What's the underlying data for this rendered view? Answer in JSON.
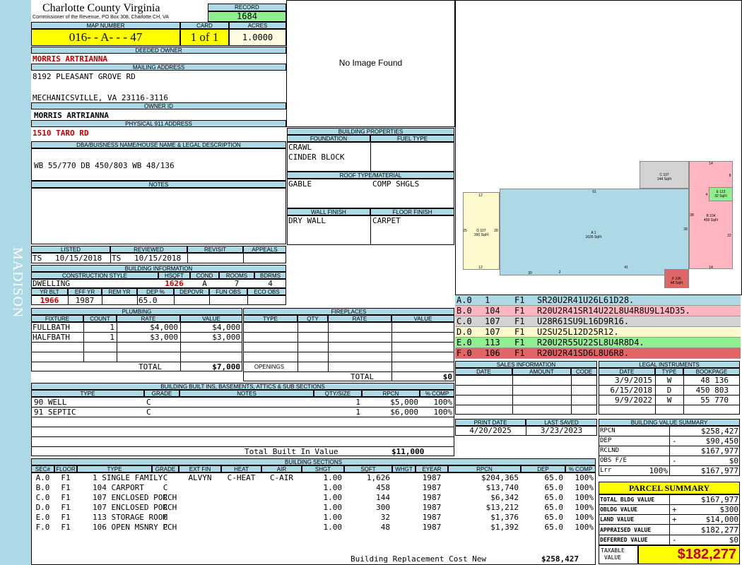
{
  "side_label": "MADISON",
  "header": {
    "county": "Charlotte County Virginia",
    "office": "Commissioner of the Revenue, PO Box 308, Charlotte CH, VA",
    "record_label": "RECORD",
    "record": "1684",
    "map_label": "MAP NUMBER",
    "map_number": "016- - A- - - 47",
    "card_label": "CARD",
    "card": "1 of 1",
    "acres_label": "ACRES",
    "acres": "1.0000"
  },
  "owner": {
    "deeded_label": "DEEDED OWNER",
    "deeded_owner": "MORRIS ARTRIANNA",
    "mailing_label": "MAILING ADDRESS",
    "address1": "8192 PLEASANT GROVE RD",
    "address2": "MECHANICSVILLE, VA 23116-3116",
    "owner_id_label": "OWNER ID",
    "owner_id": "MORRIS ARTRIANNA",
    "physical_label": "PHYSICAL 911 ADDRESS",
    "physical": "1510 TARO RD"
  },
  "dba": {
    "label": "DBA/BUISNESS NAME/HOUSE NAME & LEGAL DESCRIPTION",
    "value": "WB 55/770 DB 450/803 WB 48/136"
  },
  "notes_label": "NOTES",
  "image": {
    "text": "No Image Found"
  },
  "building_properties": {
    "label": "BUILDING PROPERTIES",
    "foundation_label": "FOUNDATION",
    "fuel_label": "FUEL TYPE",
    "foundation1": "CRAWL",
    "foundation2": "CINDER BLOCK",
    "roof_label": "ROOF TYPE/MATERIAL",
    "roof_type": "GABLE",
    "roof_material": "COMP SHGLS",
    "wall_label": "WALL FINISH",
    "floor_label": "FLOOR FINISH",
    "wall": "DRY WALL",
    "floor": "CARPET"
  },
  "dates": {
    "listed_label": "LISTED",
    "reviewed_label": "REVIEWED",
    "revisit_label": "REVISIT",
    "appeals_label": "APPEALS",
    "listed_by": "TS",
    "listed": "10/15/2018",
    "reviewed_by": "TS",
    "reviewed": "10/15/2018"
  },
  "building_info": {
    "label": "BUILDING INFORMATION",
    "style_label": "CONSTRUCTION STYLE",
    "hsqft_label": "HSQFT",
    "cond_label": "COND",
    "rooms_label": "ROOMS",
    "bdrms_label": "BDRMS",
    "style": "DWELLING",
    "hsqft": "1626",
    "cond": "A",
    "rooms": "7",
    "bdrms": "4",
    "yrblt_label": "YR BLT",
    "effyr_label": "EFF YR",
    "remyr_label": "REM YR",
    "dep_label": "DEP %",
    "depovr_label": "DEPOVR",
    "funobs_label": "FUN OBS",
    "ecoobs_label": "ECO OBS",
    "yrblt": "1966",
    "effyr": "1987",
    "dep": "65.0"
  },
  "plumbing": {
    "label": "PLUMBING",
    "headers": [
      "FIXTURE",
      "COUNT",
      "RATE",
      "VALUE"
    ],
    "rows": [
      [
        "FULLBATH",
        "1",
        "$4,000",
        "$4,000"
      ],
      [
        "HALFBATH",
        "1",
        "$3,000",
        "$3,000"
      ]
    ],
    "total_label": "TOTAL",
    "total": "$7,000"
  },
  "fireplaces": {
    "label": "FIREPLACES",
    "headers": [
      "TYPE",
      "QTY",
      "RATE",
      "VALUE"
    ],
    "openings_label": "OPENINGS",
    "total_label": "TOTAL",
    "total": "$0"
  },
  "built_ins": {
    "label": "BUILDING BUILT INS, BASEMENTS, ATTICS & SUB SECTIONS",
    "headers": [
      "TYPE",
      "GRADE",
      "NOTES",
      "QTY/SIZE",
      "RPCN",
      "% COMP"
    ],
    "rows": [
      [
        "90 WELL",
        "C",
        "",
        "1",
        "$5,000",
        "100%"
      ],
      [
        "91 SEPTIC",
        "C",
        "",
        "1",
        "$6,000",
        "100%"
      ]
    ],
    "total_label": "Total Built In Value",
    "total": "$11,000"
  },
  "sections": {
    "label": "BUILDING SECTIONS",
    "headers": [
      "SEC#",
      "FLOOR",
      "TYPE",
      "GRADE",
      "EXT FIN",
      "HEAT",
      "AIR",
      "SHGT",
      "SQFT",
      "WHGT",
      "EYEAR",
      "RPCN",
      "DEP",
      "% COMP"
    ],
    "rows": [
      [
        "A.0",
        "F1",
        "1 SINGLE FAMILY",
        "C",
        "ALVYN",
        "C-HEAT",
        "C-AIR",
        "1.00",
        "1,626",
        "",
        "1987",
        "$204,365",
        "65.0",
        "100%"
      ],
      [
        "B.0",
        "F1",
        "104 CARPORT",
        "C",
        "",
        "",
        "",
        "1.00",
        "458",
        "",
        "1987",
        "$13,740",
        "65.0",
        "100%"
      ],
      [
        "C.0",
        "F1",
        "107 ENCLOSED PORCH",
        "C",
        "",
        "",
        "",
        "1.00",
        "144",
        "",
        "1987",
        "$6,342",
        "65.0",
        "100%"
      ],
      [
        "D.0",
        "F1",
        "107 ENCLOSED PORCH",
        "C",
        "",
        "",
        "",
        "1.00",
        "300",
        "",
        "1987",
        "$13,212",
        "65.0",
        "100%"
      ],
      [
        "E.0",
        "F1",
        "113 STORAGE ROOM",
        "C",
        "",
        "",
        "",
        "1.00",
        "32",
        "",
        "1987",
        "$1,376",
        "65.0",
        "100%"
      ],
      [
        "F.0",
        "F1",
        "106 OPEN MSNRY PCH",
        "C",
        "",
        "",
        "",
        "1.00",
        "48",
        "",
        "1987",
        "$1,392",
        "65.0",
        "100%"
      ]
    ],
    "total_label": "Building Replacement Cost New",
    "total": "$258,427"
  },
  "sketch": {
    "labels": [
      {
        "id": "A",
        "name": "A 1",
        "area": "1626 SqFt"
      },
      {
        "id": "B",
        "name": "B 104",
        "area": "458 SqFt"
      },
      {
        "id": "C",
        "name": "C 107",
        "area": "144 SqFt"
      },
      {
        "id": "D",
        "name": "D 107",
        "area": "300 SqFt"
      },
      {
        "id": "E",
        "name": "E 113",
        "area": "32 SqFt"
      },
      {
        "id": "F",
        "name": "F 106",
        "area": "48 SqFt"
      }
    ],
    "dims": [
      "12",
      "61",
      "25",
      "28",
      "30",
      "2",
      "41",
      "12",
      "14",
      "8",
      "4",
      "22",
      "14",
      "38",
      "28",
      "22",
      "14"
    ],
    "colors": {
      "A": "#add8e6",
      "B": "#ffb6c1",
      "C": "#d3d3d3",
      "D": "#fffacd",
      "E": "#90ee90",
      "F": "#e06666"
    }
  },
  "section_codes": [
    {
      "sec": "A.0",
      "num": "1",
      "floor": "F1",
      "code": "SR20U2R41U26L61D28.",
      "color": "#add8e6"
    },
    {
      "sec": "B.0",
      "num": "104",
      "floor": "F1",
      "code": "R20U2R41SR14U22L8U4R8U9L14D35.",
      "color": "#ffb6c1"
    },
    {
      "sec": "C.0",
      "num": "107",
      "floor": "F1",
      "code": "U28R61SU9L16D9R16.",
      "color": "#d3d3d3"
    },
    {
      "sec": "D.0",
      "num": "107",
      "floor": "F1",
      "code": "U2SU25L12D25R12.",
      "color": "#fffacd"
    },
    {
      "sec": "E.0",
      "num": "113",
      "floor": "F1",
      "code": "R20U2R55U22SL8U4R8D4.",
      "color": "#90ee90"
    },
    {
      "sec": "F.0",
      "num": "106",
      "floor": "F1",
      "code": "R20U2R41SD6L8U6R8.",
      "color": "#e06666"
    }
  ],
  "sales": {
    "label": "SALES INFORMATION",
    "headers": [
      "DATE",
      "AMOUNT",
      "CODE"
    ]
  },
  "legal": {
    "label": "LEGAL INSTRUMENTS",
    "headers": [
      "DATE",
      "TYPE",
      "BOOKPAGE"
    ],
    "rows": [
      [
        "3/9/2015",
        "W",
        "48 136"
      ],
      [
        "6/15/2018",
        "D",
        "450 803"
      ],
      [
        "9/9/2022",
        "W",
        "55 770"
      ]
    ]
  },
  "print": {
    "print_label": "PRINT DATE",
    "saved_label": "LAST SAVED",
    "print_date": "4/20/2025",
    "last_saved": "3/23/2023"
  },
  "value_summary": {
    "label": "BUILDING VALUE SUMMARY",
    "rpcn_label": "RPCN",
    "rpcn": "$258,427",
    "dep_label": "DEP",
    "dep_sign": "-",
    "dep": "$90,450",
    "rclnd_label": "RCLND",
    "rclnd": "$167,977",
    "obs_label": "OBS F/E",
    "obs_sign": "-",
    "obs": "$0",
    "lrr_label": "Lrr",
    "lrr_pct": "100%",
    "lrr": "$167,977"
  },
  "parcel": {
    "label": "PARCEL SUMMARY",
    "total_bldg_label": "TOTAL BLDG VALUE",
    "total_bldg": "$167,977",
    "obldg_label": "OBLDG VALUE",
    "obldg_sign": "+",
    "obldg": "$300",
    "land_label": "LAND VALUE",
    "land_sign": "+",
    "land": "$14,000",
    "appraised_label": "APPRAISED VALUE",
    "appraised": "$182,277",
    "deferred_label": "DEFERRED VALUE",
    "deferred_sign": "-",
    "deferred": "$0",
    "taxable_label1": "TAXABLE",
    "taxable_label2": "VALUE",
    "taxable": "$182,277"
  }
}
